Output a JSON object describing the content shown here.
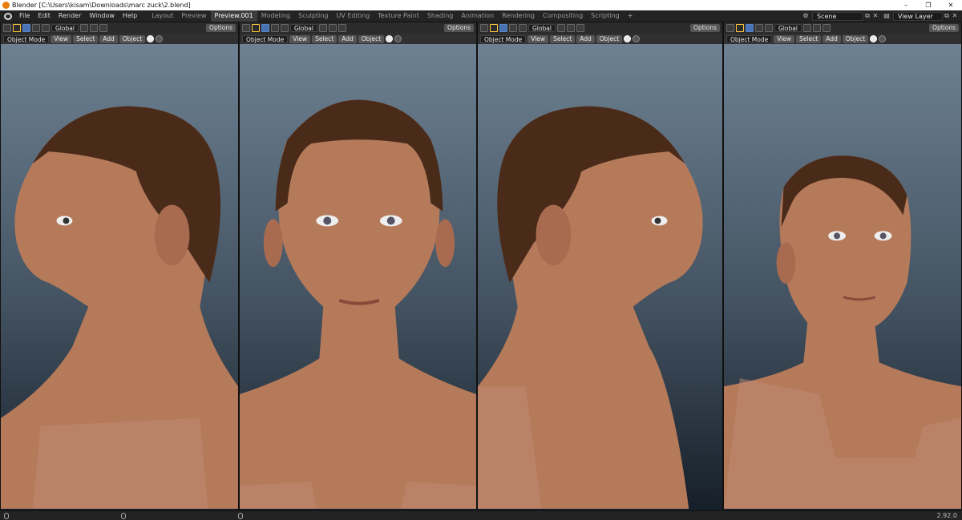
{
  "window": {
    "title": "Blender [C:\\Users\\kisam\\Downloads\\marc zuck\\2.blend]",
    "controls": [
      "–",
      "❐",
      "✕"
    ]
  },
  "menu": [
    "File",
    "Edit",
    "Render",
    "Window",
    "Help"
  ],
  "workspaces": [
    {
      "label": "Layout",
      "active": false
    },
    {
      "label": "Preview",
      "active": false
    },
    {
      "label": "Preview.001",
      "active": true
    },
    {
      "label": "Modeling",
      "active": false
    },
    {
      "label": "Sculpting",
      "active": false
    },
    {
      "label": "UV Editing",
      "active": false
    },
    {
      "label": "Texture Paint",
      "active": false
    },
    {
      "label": "Shading",
      "active": false
    },
    {
      "label": "Animation",
      "active": false
    },
    {
      "label": "Rendering",
      "active": false
    },
    {
      "label": "Compositing",
      "active": false
    },
    {
      "label": "Scripting",
      "active": false
    }
  ],
  "add_workspace": "+",
  "scene": {
    "label": "Scene",
    "view_layer": "View Layer"
  },
  "viewport": {
    "transform_orientation": "Global",
    "options": "Options",
    "mode": "Object Mode",
    "header_menus": [
      "View",
      "Select",
      "Add",
      "Object"
    ]
  },
  "views": [
    {
      "id": "left-profile",
      "description": "left side profile"
    },
    {
      "id": "front",
      "description": "front view"
    },
    {
      "id": "right-profile",
      "description": "right side profile"
    },
    {
      "id": "three-quarter",
      "description": "three-quarter view"
    }
  ],
  "status": {
    "version": "2.92.0"
  },
  "colors": {
    "viewport_top": "#6d8192",
    "viewport_bottom": "#161f29",
    "skin": "#b57a5a",
    "hair": "#4a2b1a",
    "accent": "#4772b3"
  }
}
